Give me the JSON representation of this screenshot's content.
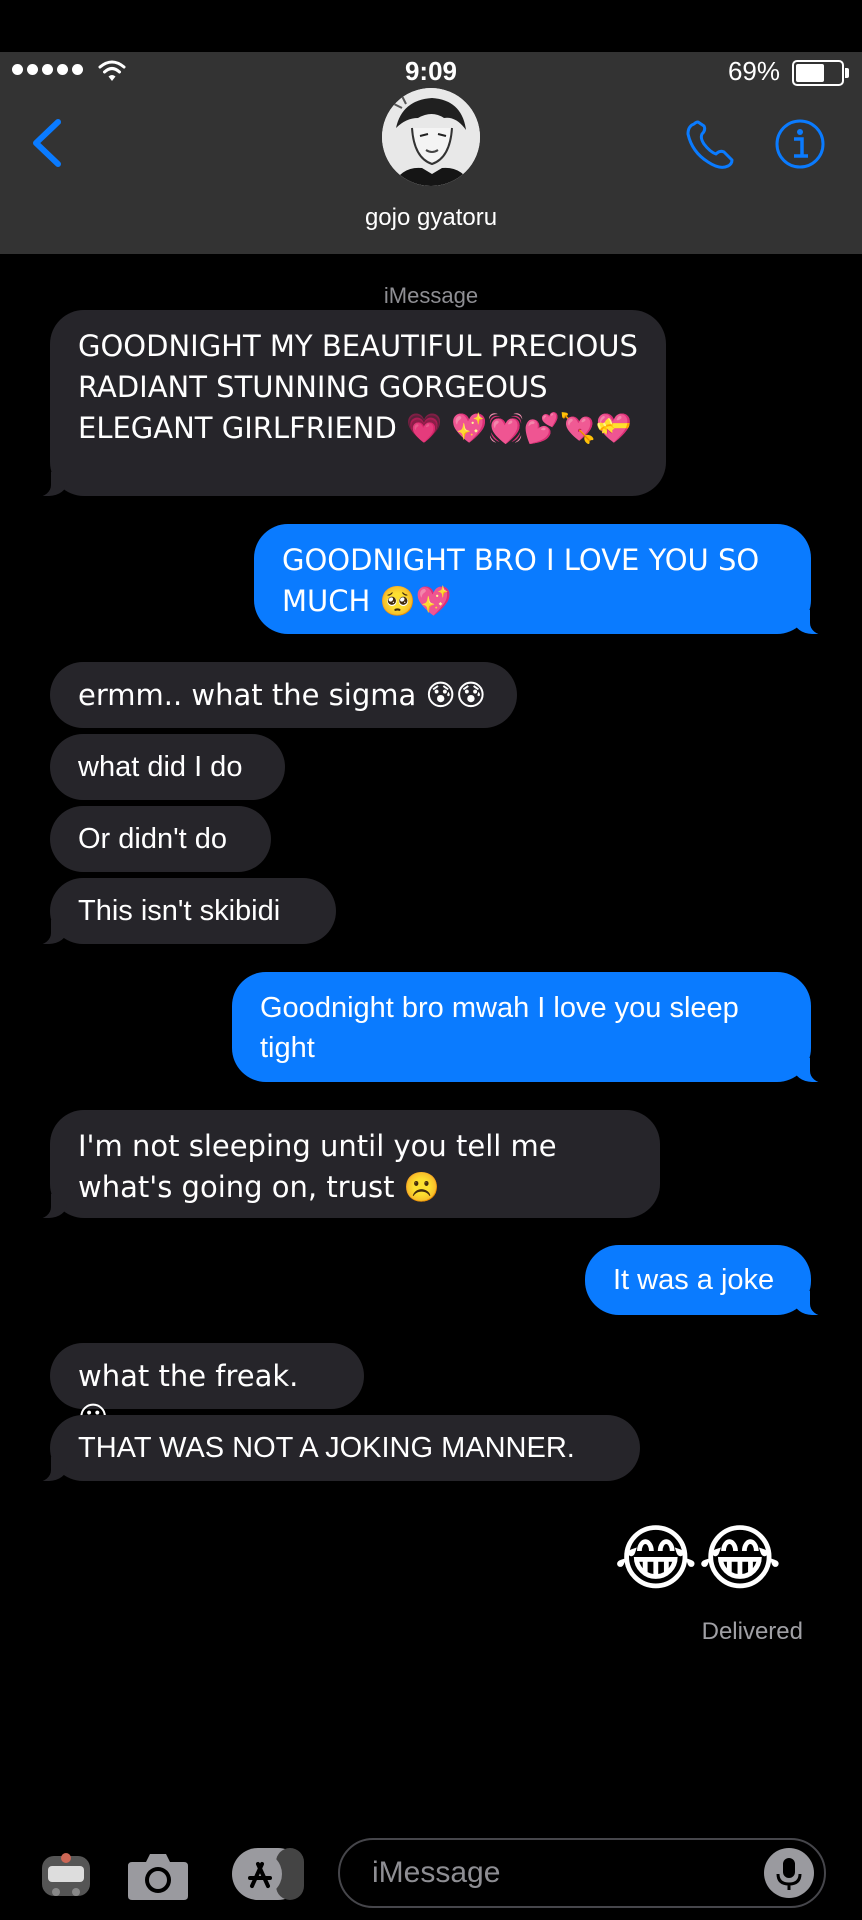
{
  "status_bar": {
    "time": "9:09",
    "battery_percent": "69%",
    "battery_level": 0.69
  },
  "header": {
    "back_icon": "chevron-left-icon",
    "contact_name": "gojo gyatoru",
    "call_icon": "phone-icon",
    "info_icon": "info-icon"
  },
  "thread": {
    "service_label": "iMessage",
    "messages": [
      {
        "from": "them",
        "text": "GOODNIGHT MY BEAUTIFUL PRECIOUS RADIANT STUNNING GORGEOUS ELEGANT GIRLFRIEND 💗 💖💓💕💘💝"
      },
      {
        "from": "me",
        "text": "GOODNIGHT BRO I LOVE YOU SO MUCH 🥺💖"
      },
      {
        "from": "them",
        "text": "ermm.. what the sigma 😰😰"
      },
      {
        "from": "them",
        "text": "what did I do"
      },
      {
        "from": "them",
        "text": "Or didn't do"
      },
      {
        "from": "them",
        "text": "This isn't skibidi"
      },
      {
        "from": "me",
        "text": "Goodnight bro mwah I love you sleep tight"
      },
      {
        "from": "them",
        "text": "I'm not sleeping until you tell me what's going on, trust ☹️"
      },
      {
        "from": "me",
        "text": "It was a joke"
      },
      {
        "from": "them",
        "text": "what the freak. 😐"
      },
      {
        "from": "them",
        "text": "THAT WAS NOT A JOKING MANNER."
      },
      {
        "from": "me",
        "text": "😂😂"
      }
    ],
    "delivered_label": "Delivered"
  },
  "toolbar": {
    "icons": [
      "sticker-app-icon",
      "camera-icon",
      "app-store-icon"
    ],
    "input_placeholder": "iMessage",
    "mic_icon": "microphone-icon"
  },
  "colors": {
    "incoming_bubble": "#26252a",
    "outgoing_bubble": "#0a7bff",
    "header_bg": "#333333",
    "accent": "#0a7bff"
  }
}
